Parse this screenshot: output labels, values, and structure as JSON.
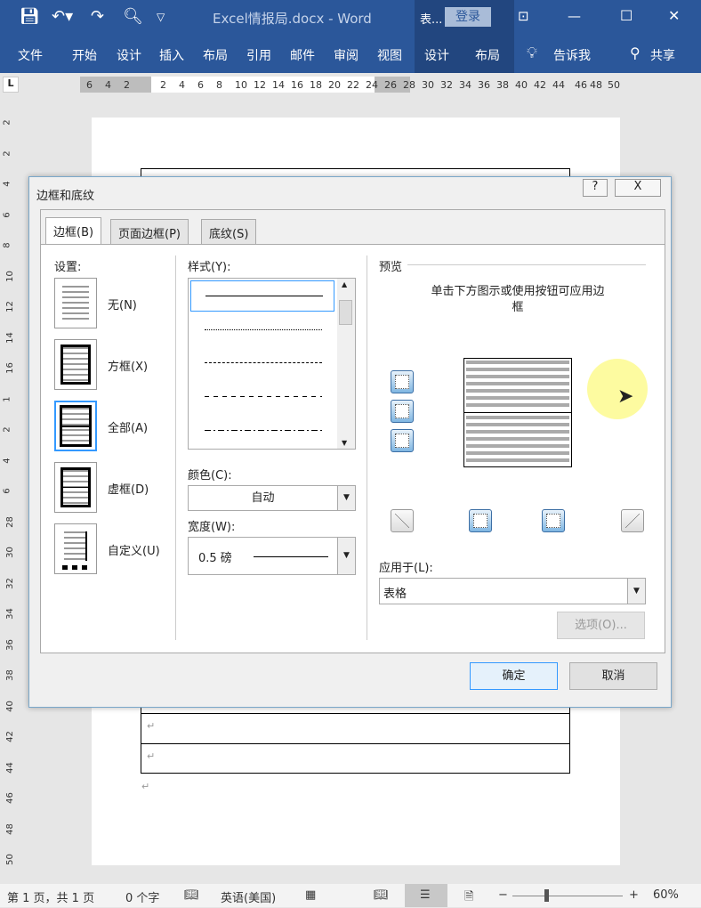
{
  "titlebar": {
    "doc_title": "Excel情报局.docx  -  Word",
    "context_label": "表...",
    "login": "登录"
  },
  "ribbon": {
    "tabs": [
      "文件",
      "开始",
      "设计",
      "插入",
      "布局",
      "引用",
      "邮件",
      "审阅",
      "视图",
      "设计",
      "布局"
    ],
    "tell_me": "告诉我",
    "share": "共享"
  },
  "ruler": {
    "left": [
      "6",
      "4",
      "2"
    ],
    "main": [
      "2",
      "4",
      "6",
      "8",
      "10",
      "12",
      "14",
      "16",
      "18",
      "20",
      "22",
      "24",
      "26",
      "28",
      "30",
      "32",
      "34",
      "36",
      "38",
      "40",
      "42",
      "44"
    ],
    "right": [
      "46",
      "48",
      "50"
    ]
  },
  "vruler": [
    "2",
    "2",
    "4",
    "6",
    "8",
    "10",
    "12",
    "14",
    "16",
    "1",
    "2",
    "4",
    "6",
    "28",
    "30",
    "32",
    "34",
    "36",
    "38",
    "40",
    "42",
    "44",
    "46",
    "48",
    "50"
  ],
  "dialog": {
    "title": "边框和底纹",
    "help": "?",
    "close": "X",
    "tabs": [
      "边框(B)",
      "页面边框(P)",
      "底纹(S)"
    ],
    "settings_label": "设置:",
    "settings": [
      "无(N)",
      "方框(X)",
      "全部(A)",
      "虚框(D)",
      "自定义(U)"
    ],
    "style_label": "样式(Y):",
    "color_label": "颜色(C):",
    "color_value": "自动",
    "width_label": "宽度(W):",
    "width_value": "0.5 磅",
    "preview_label": "预览",
    "preview_hint": "单击下方图示或使用按钮可应用边框",
    "apply_label": "应用于(L):",
    "apply_value": "表格",
    "options": "选项(O)...",
    "ok": "确定",
    "cancel": "取消"
  },
  "status": {
    "page": "第 1 页，共 1 页",
    "words": "0 个字",
    "language": "英语(美国)",
    "zoom_minus": "−",
    "zoom_plus": "+",
    "zoom": "60%",
    "zoom_level": 60
  },
  "colors": {
    "accent": "#2b579a",
    "selected": "#3399ff"
  }
}
